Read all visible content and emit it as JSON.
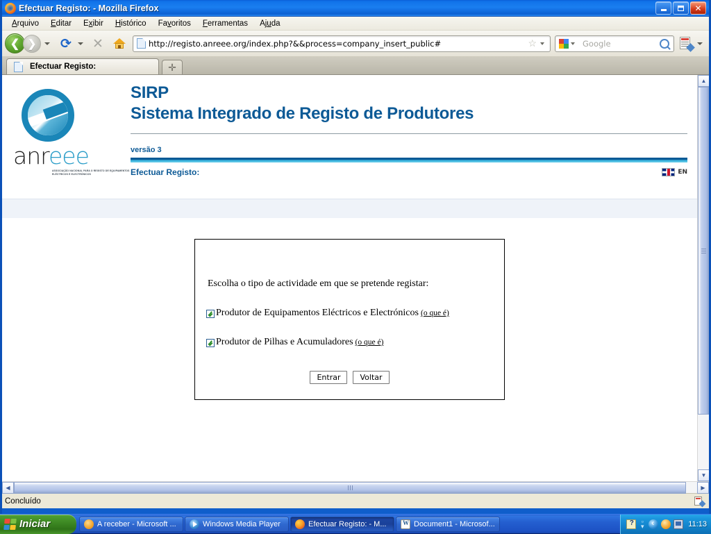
{
  "window": {
    "title": "Efectuar Registo: - Mozilla Firefox",
    "icon": "firefox-icon",
    "minimize_label": "Minimizar",
    "maximize_label": "Restaurar",
    "close_label": "Fechar"
  },
  "menubar": {
    "items": [
      {
        "label": "Arquivo",
        "name": "menu-arquivo"
      },
      {
        "label": "Editar",
        "name": "menu-editar"
      },
      {
        "label": "Exibir",
        "name": "menu-exibir"
      },
      {
        "label": "Histórico",
        "name": "menu-historico"
      },
      {
        "label": "Favoritos",
        "name": "menu-favoritos"
      },
      {
        "label": "Ferramentas",
        "name": "menu-ferramentas"
      },
      {
        "label": "Ajuda",
        "name": "menu-ajuda"
      }
    ]
  },
  "navbar": {
    "back_glyph": "❮",
    "forward_glyph": "❯",
    "reload_glyph": "⟳",
    "stop_glyph": "✕",
    "url": "http://registo.anreee.org/index.php?&&process=company_insert_public#",
    "star_glyph": "☆",
    "search_placeholder": "Google"
  },
  "tabs": {
    "items": [
      {
        "label": "Efectuar Registo:",
        "active": true
      }
    ],
    "newtab_glyph": "✛"
  },
  "page": {
    "logo": {
      "wordmark_pre": "anr",
      "wordmark_post": "eee",
      "subtitle": "ASSOCIAÇÃO NACIONAL PARA O REGISTO DE EQUIPAMENTOS ELÉCTRICOS E ELECTRÓNICOS"
    },
    "header": {
      "acronym": "SIRP",
      "full_name": "Sistema Integrado de Registo de Produtores",
      "version": "versão 3",
      "breadcrumb": "Efectuar Registo:",
      "language_code": "EN"
    },
    "form": {
      "prompt": "Escolha o tipo de actividade em que se pretende registar:",
      "options": [
        {
          "label": "Produtor de Equipamentos Eléctricos e Electrónicos",
          "help_link": "(o que é)",
          "checked": true
        },
        {
          "label": "Produtor de Pilhas e Acumuladores",
          "help_link": "(o que é)",
          "checked": true
        }
      ],
      "submit_label": "Entrar",
      "back_label": "Voltar"
    }
  },
  "statusbar": {
    "text": "Concluído"
  },
  "scrollbars": {
    "up_glyph": "▲",
    "down_glyph": "▼",
    "left_glyph": "◀",
    "right_glyph": "▶"
  },
  "taskbar": {
    "start_label": "Iniciar",
    "items": [
      {
        "label": "A receber - Microsoft ...",
        "icon": "outlook-icon",
        "active": false
      },
      {
        "label": "Windows Media Player",
        "icon": "wmp-icon",
        "active": false
      },
      {
        "label": "Efectuar Registo: - M...",
        "icon": "firefox-icon",
        "active": true
      },
      {
        "label": "Document1 - Microsof...",
        "icon": "word-icon",
        "active": false
      }
    ],
    "clock": "11:13"
  },
  "colors": {
    "brand_blue": "#0d5a96",
    "accent_cyan": "#2aa8d6",
    "logo_blue": "#2a9dc8",
    "strip": "#eff3f9"
  }
}
